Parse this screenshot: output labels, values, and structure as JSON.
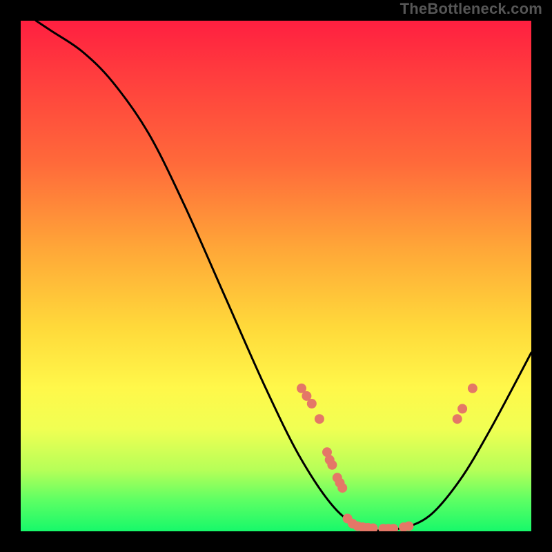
{
  "watermark": "TheBottleneck.com",
  "colors": {
    "background": "#000000",
    "watermark_text": "#565656",
    "curve_stroke": "#000000",
    "marker_fill": "#e47767",
    "gradient_stops": [
      "#ff1f40",
      "#ff3b3e",
      "#ff6a3a",
      "#ffa838",
      "#ffd93a",
      "#fff84a",
      "#f0ff53",
      "#b6ff58",
      "#5cff64",
      "#17f86a"
    ]
  },
  "chart_data": {
    "type": "line",
    "title": "",
    "xlabel": "",
    "ylabel": "",
    "xlim": [
      0,
      100
    ],
    "ylim": [
      0,
      100
    ],
    "curve": [
      {
        "x": 3,
        "y": 100
      },
      {
        "x": 6,
        "y": 98
      },
      {
        "x": 12,
        "y": 94
      },
      {
        "x": 18,
        "y": 88
      },
      {
        "x": 25,
        "y": 78
      },
      {
        "x": 32,
        "y": 64
      },
      {
        "x": 40,
        "y": 46
      },
      {
        "x": 48,
        "y": 28
      },
      {
        "x": 55,
        "y": 14
      },
      {
        "x": 62,
        "y": 4
      },
      {
        "x": 68,
        "y": 0.5
      },
      {
        "x": 74,
        "y": 0.5
      },
      {
        "x": 80,
        "y": 3
      },
      {
        "x": 86,
        "y": 10
      },
      {
        "x": 92,
        "y": 20
      },
      {
        "x": 100,
        "y": 35
      }
    ],
    "markers": [
      {
        "x": 55,
        "y": 28
      },
      {
        "x": 56,
        "y": 26.5
      },
      {
        "x": 57,
        "y": 25
      },
      {
        "x": 58.5,
        "y": 22
      },
      {
        "x": 60,
        "y": 15.5
      },
      {
        "x": 60.5,
        "y": 14
      },
      {
        "x": 61,
        "y": 13
      },
      {
        "x": 62,
        "y": 10.5
      },
      {
        "x": 62.5,
        "y": 9.5
      },
      {
        "x": 63,
        "y": 8.5
      },
      {
        "x": 64,
        "y": 2.5
      },
      {
        "x": 65,
        "y": 1.5
      },
      {
        "x": 66,
        "y": 1
      },
      {
        "x": 67,
        "y": 0.8
      },
      {
        "x": 68,
        "y": 0.7
      },
      {
        "x": 69,
        "y": 0.6
      },
      {
        "x": 71,
        "y": 0.5
      },
      {
        "x": 72,
        "y": 0.5
      },
      {
        "x": 73,
        "y": 0.5
      },
      {
        "x": 75,
        "y": 0.8
      },
      {
        "x": 76,
        "y": 1
      },
      {
        "x": 85.5,
        "y": 22
      },
      {
        "x": 86.5,
        "y": 24
      },
      {
        "x": 88.5,
        "y": 28
      }
    ]
  }
}
